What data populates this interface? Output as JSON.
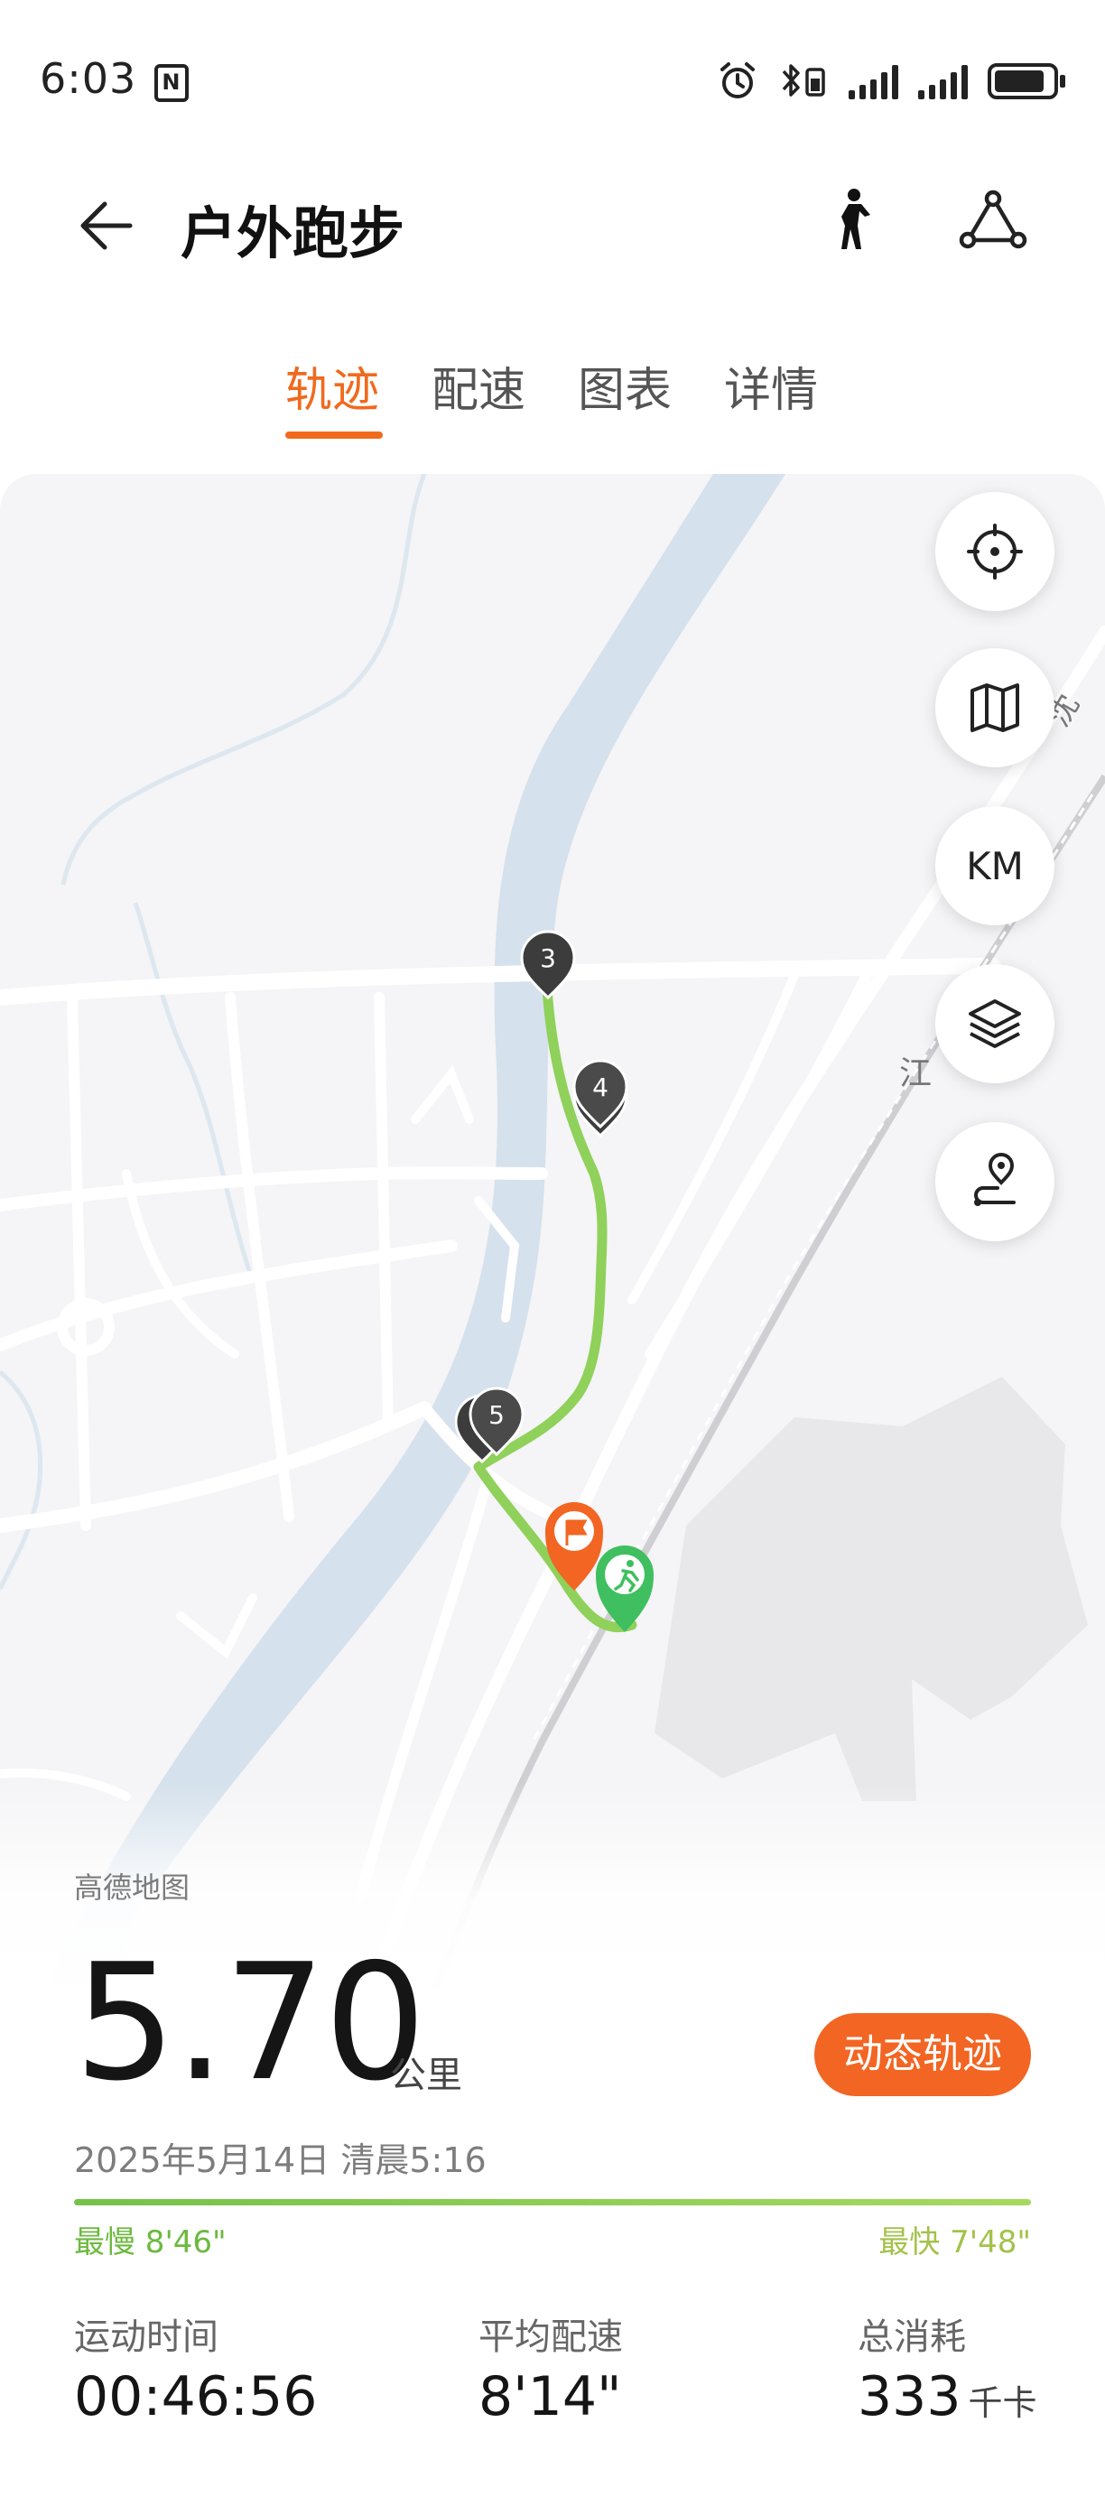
{
  "status_bar": {
    "time": "6:03",
    "nfc_label": "N",
    "icons": [
      "alarm-icon",
      "bluetooth-icon",
      "signal-icon",
      "signal-icon",
      "battery-icon"
    ]
  },
  "header": {
    "title": "户外跑步",
    "back_icon": "arrow-left-icon",
    "right_icons": [
      "runner-pose-icon",
      "route-share-icon"
    ]
  },
  "tabs": [
    {
      "label": "轨迹",
      "active": true
    },
    {
      "label": "配速",
      "active": false
    },
    {
      "label": "图表",
      "active": false
    },
    {
      "label": "详情",
      "active": false
    }
  ],
  "map": {
    "controls": {
      "locate_icon": "crosshair-icon",
      "map_icon": "map-icon",
      "unit_label": "KM",
      "layers_icon": "layers-icon",
      "route_icon": "route-pin-icon"
    },
    "km_markers": [
      "3",
      "4",
      "5"
    ],
    "place_label": "江",
    "road_label": "沈"
  },
  "summary": {
    "attribution": "高德地图",
    "distance": "5.70",
    "distance_unit": "公里",
    "dynamic_track_button": "动态轨迹",
    "date": "2025年5月14日 清晨5:16",
    "slowest": "最慢 8'46\"",
    "fastest": "最快 7'48\""
  },
  "stats": [
    {
      "label": "运动时间",
      "value": "00:46:56",
      "unit": ""
    },
    {
      "label": "平均配速",
      "value": "8'14\"",
      "unit": ""
    },
    {
      "label": "总消耗",
      "value": "333",
      "unit": "千卡"
    }
  ],
  "colors": {
    "accent": "#f06a1e",
    "button": "#f26522",
    "route": "#8fd15a",
    "river": "#d5e1ec",
    "marker": "#3c3c3c"
  }
}
